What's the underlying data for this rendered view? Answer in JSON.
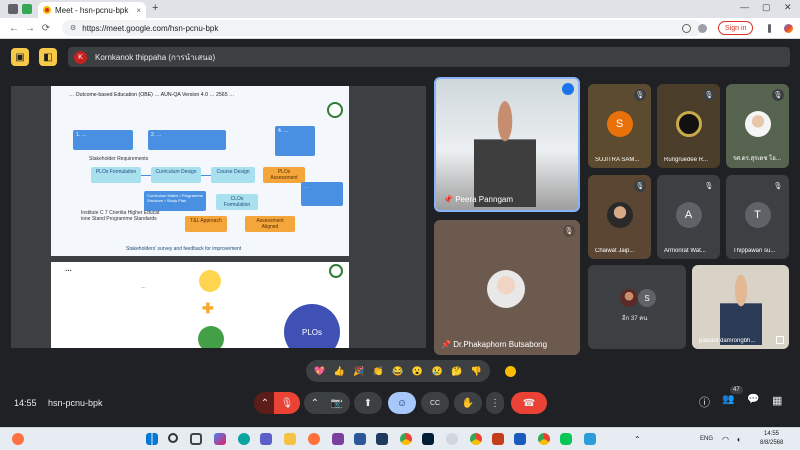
{
  "browser": {
    "tab_title": "Meet - hsn-pcnu-bpk",
    "tab_close": "×",
    "new_tab": "+",
    "url": "https://meet.google.com/hsn-pcnu-bpk",
    "signin_label": "Sign in",
    "back": "←",
    "forward": "→",
    "reload": "⟳",
    "win_min": "—",
    "win_max": "▢",
    "win_close": "✕"
  },
  "meet": {
    "presenter": {
      "initial": "K",
      "name": "Kornkanok thippaha (การนำเสนอ)"
    },
    "slide1": {
      "title": "… Outcome-based Education (OBE) … AUN-QA Version 4.0 … 2565 …",
      "box1": "1. …",
      "box2": "2. …",
      "box4": "4. …",
      "stakeholder": "Stakeholder Requirements",
      "plos_form": "PLOs Formulation",
      "curr_design": "Curriculum Design",
      "course_design": "Course Design",
      "plos_assess": "PLOs Assessment",
      "curr_matrix": "Curriculum Matrix • Programme Structure • Study Plan",
      "clos_form": "CLOs Formulation",
      "tl_approach": "T&L Approach",
      "assess_aligned": "Assessment Aligned",
      "side_note": "…",
      "institute": "Institute C  7 Crieritia Higher Educat ione Stand Programme Standards",
      "footer": "Stakeholders' survey and feedback for improvement"
    },
    "slide2": {
      "title": "…",
      "sub": "…",
      "plus": "✚",
      "plos": "PLOs"
    },
    "main_speaker": {
      "name": "Peera Panngam"
    },
    "second_speaker": {
      "name": "Dr.Phakaphorn Butsabong"
    },
    "participants": [
      {
        "name": "SUJITRA SAM...",
        "initial": "S",
        "color": "#e8710a"
      },
      {
        "name": "Rungruedee R...",
        "initial": "",
        "color": "#5f4b1e"
      },
      {
        "name": "รศ.ดร.สุรเดช โอ...",
        "initial": "",
        "color": "#4a5a4a"
      },
      {
        "name": "Chaiwat Jaip...",
        "initial": "",
        "color": "#6b5340"
      },
      {
        "name": "Armonrat Wat...",
        "initial": "A",
        "color": "#5f6368"
      },
      {
        "name": "Thippawan su...",
        "initial": "T",
        "color": "#5f6368"
      },
      {
        "name": "อีก 37 คน",
        "initial": "S",
        "color": "#5f6368"
      },
      {
        "name": "pawarit damrongbh...",
        "initial": "",
        "color": "#c9c2b5"
      }
    ],
    "reactions": [
      "💖",
      "👍",
      "🎉",
      "👏",
      "😂",
      "😮",
      "😢",
      "🤔",
      "👎"
    ],
    "controls": {
      "time": "14:55",
      "code": "hsn-pcnu-bpk",
      "people_count": "47"
    },
    "icons": {
      "mic_off": "🎙",
      "pin": "📌",
      "hand": "✋",
      "more": "⋮",
      "end_call": "☎",
      "camera": "📷",
      "present": "⬆",
      "emoji": "☺",
      "captions": "CC",
      "info": "ⓘ",
      "people": "👥",
      "chat": "💬",
      "activities": "▦",
      "chevron": "⌃"
    }
  },
  "taskbar": {
    "lang": "ENG",
    "time": "14:55",
    "date": "8/8/2568"
  }
}
